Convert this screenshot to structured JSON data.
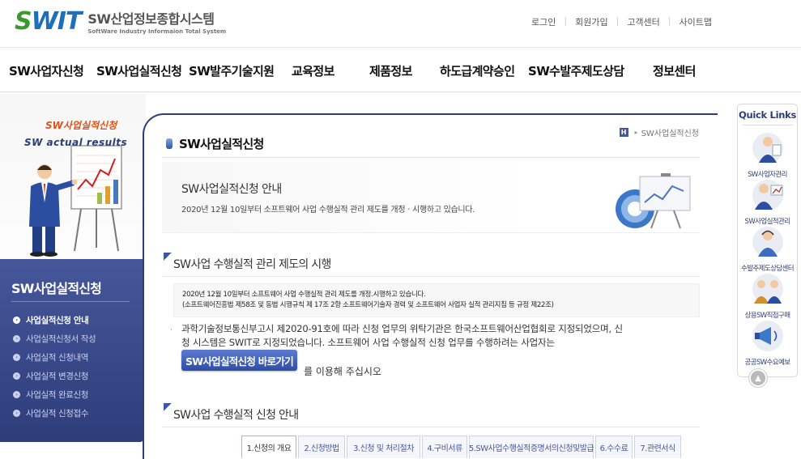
{
  "header": {
    "logo_mark_s": "S",
    "logo_mark_rest": "WIT",
    "logo_title": "SW산업정보종합시스템",
    "logo_subtitle": "SoftWare Industry Informaion Total System",
    "util_nav": [
      "로그인",
      "회원가입",
      "고객센터",
      "사이트맵"
    ]
  },
  "gnb": [
    "SW사업자신청",
    "SW사업실적신청",
    "SW발주기술지원",
    "교육정보",
    "제품정보",
    "하도급계약승인",
    "SW수발주제도상담",
    "정보센터"
  ],
  "visual": {
    "title_kr": "SW사업실적신청",
    "title_en": "SW actual results"
  },
  "lnb": {
    "title": "SW사업실적신청",
    "items": [
      "사업실적신청 안내",
      "사업실적신청서 작성",
      "사업실적 신청내역",
      "사업실적 변경신청",
      "사업실적 완료신청",
      "사업실적 신청접수"
    ],
    "active_index": 0
  },
  "breadcrumb": {
    "home": "H",
    "current": "SW사업실적신청"
  },
  "page": {
    "title": "SW사업실적신청",
    "intro_heading": "SW사업실적신청 안내",
    "intro_text": "2020년 12월 10일부터 소프트웨어 사업 수행실적 관리 제도를 개정ㆍ시행하고 있습니다.",
    "section1_title": "SW사업 수행실적 관리 제도의 시행",
    "notice_line1": "2020년 12월 10일부터 소프트웨어 사업 수행실적 관리 제도를 개정.시행하고 있습니다.",
    "notice_line2": "(소프트웨어진흥법 제58조 및 동법 시행규칙 제 17조 2항 소프트웨어기술자 경력 및 소프트웨어 사업자 실적 관리지침 등 규정 제22조)",
    "body_line1": "과학기술정보통신부고시 제2020-91호에 따라 신청 업무의 위탁기관은 한국소프트웨어산업협회로 지정되었으며, 신",
    "body_line2": "청 시스템은 SWIT로 지정되었습니다. 소프트웨어 사업 수행실적 신청 업무를 수행하려는 사업자는",
    "go_button": "SW사업실적신청 바로가기",
    "go_after": "를 이용해 주십시오",
    "section2_title": "SW사업 수행실적 신청 안내",
    "tabs": [
      "1.신청의 개요",
      "2.신청방법",
      "3.신청 및 처리절차",
      "4.구비서류",
      "5.SW사업수행실적증명서의신청및발급",
      "6.수수료",
      "7.관련서식"
    ],
    "active_tab": 0
  },
  "quick_links": {
    "title": "Quick Links",
    "items": [
      "SW사업자관리",
      "SW사업실적관리",
      "수발주제도상담센터",
      "상용SW직접구매",
      "공공SW수요예보"
    ]
  },
  "colors": {
    "brand_navy": "#2e3d7a",
    "accent_blue": "#2d4da5",
    "logo_green": "#3a9a2e",
    "logo_blue": "#1c6fb8",
    "visual_orange": "#e0541a"
  }
}
